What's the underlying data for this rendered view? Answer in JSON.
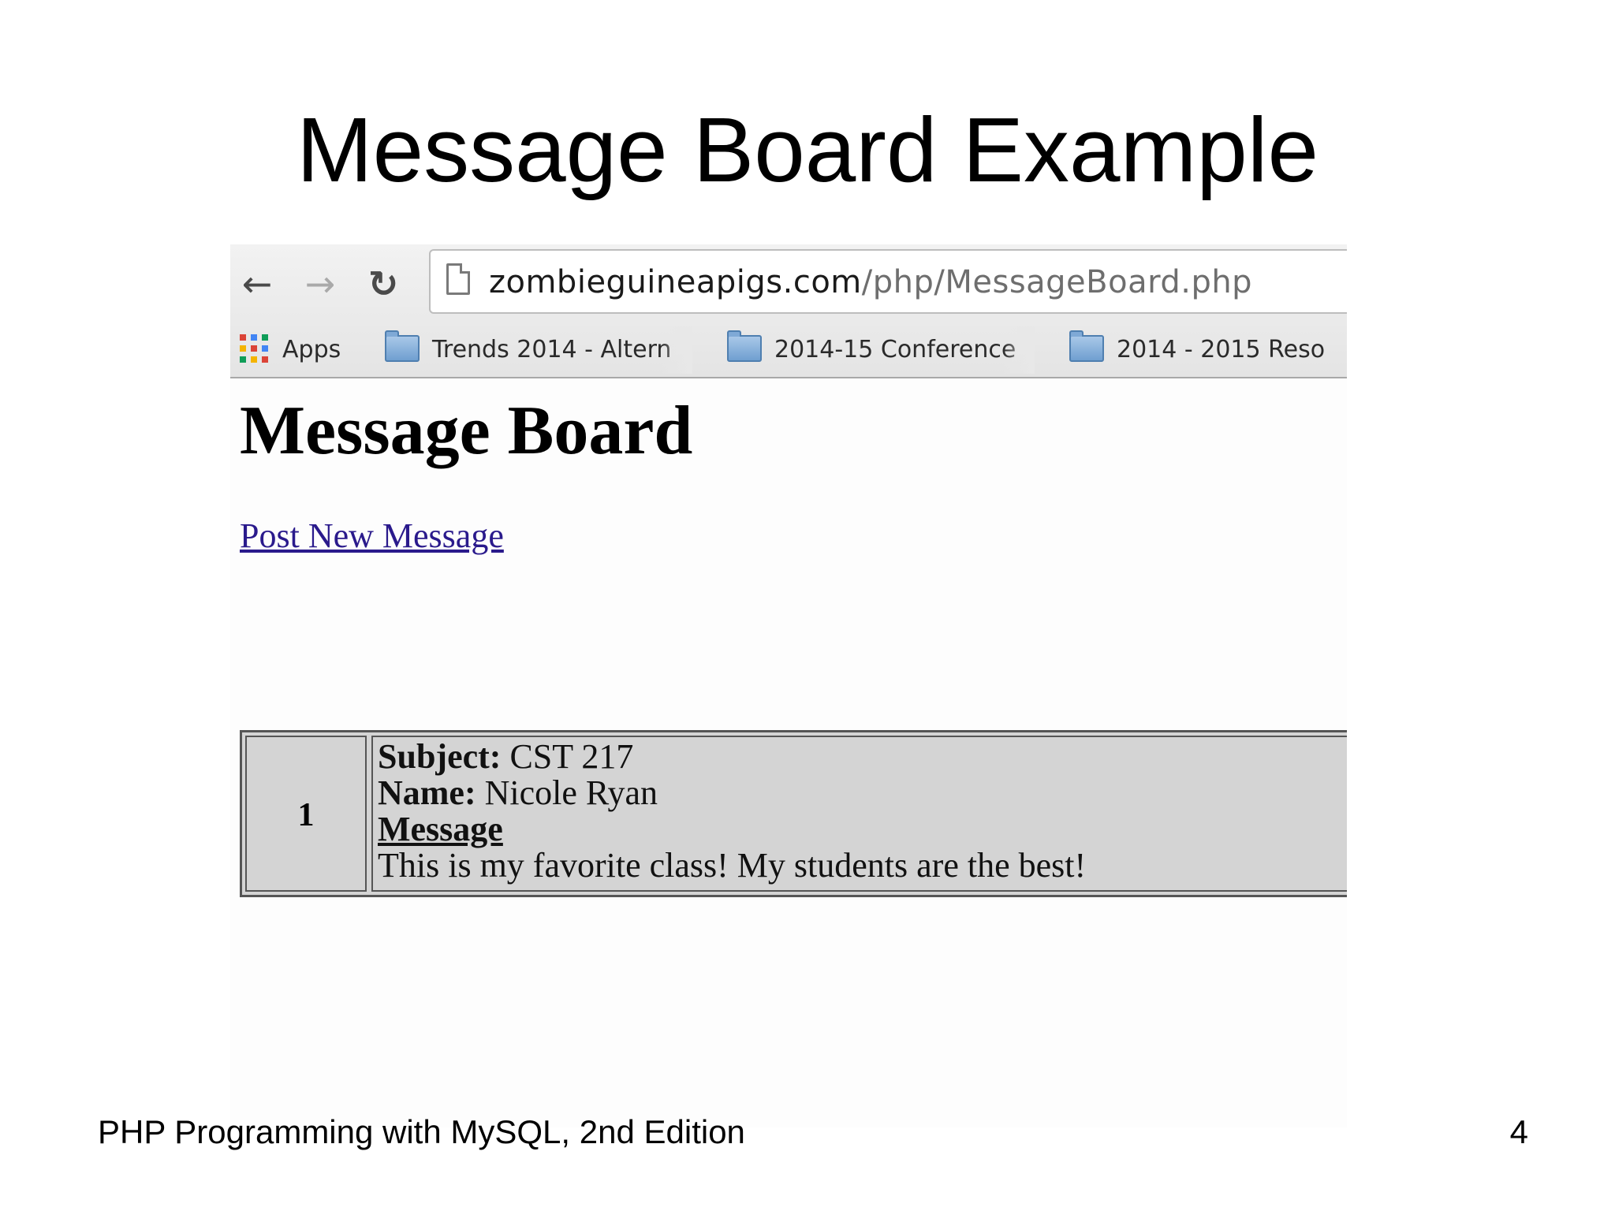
{
  "slide": {
    "title": "Message Board Example",
    "footer_text": "PHP Programming with MySQL, 2nd Edition",
    "page_number": "4"
  },
  "browser": {
    "nav": {
      "back_glyph": "←",
      "forward_glyph": "→",
      "reload_glyph": "↻"
    },
    "address": {
      "host": "zombieguineapigs.com",
      "path": "/php/MessageBoard.php"
    },
    "bookmarks": [
      {
        "label": "Apps",
        "icon": "apps-grid-icon"
      },
      {
        "label": "Trends 2014 - Altern",
        "icon": "folder-icon"
      },
      {
        "label": "2014-15 Conference",
        "icon": "folder-icon"
      },
      {
        "label": "2014 - 2015 Reso",
        "icon": "folder-icon"
      }
    ]
  },
  "page": {
    "heading": "Message Board",
    "post_link": "Post New Message",
    "messages": [
      {
        "number": "1",
        "subject_label": "Subject:",
        "subject": "CST 217",
        "name_label": "Name:",
        "name": "Nicole Ryan",
        "message_label": "Message",
        "message": "This is my favorite class! My students are the best!"
      }
    ]
  },
  "colors": {
    "link": "#2a1a8c",
    "table_bg": "#d4d4d4",
    "toolbar_bg": "#e8e8e8"
  }
}
